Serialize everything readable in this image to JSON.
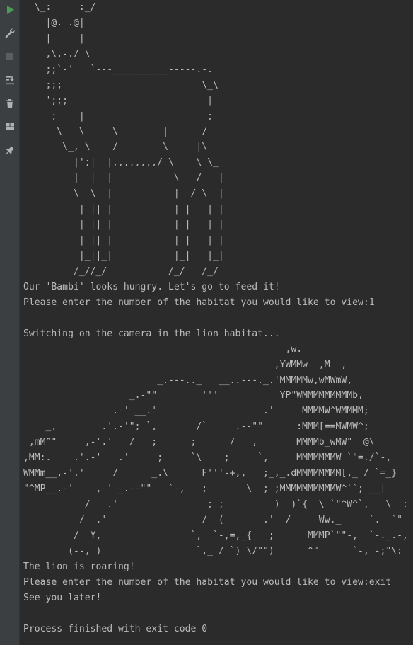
{
  "toolbar": {
    "icons": [
      "run-icon",
      "wrench-icon",
      "stop-icon",
      "scroll-to-end-icon",
      "trash-icon",
      "layout-icon",
      "pin-icon"
    ],
    "colors": {
      "run": "#499c54",
      "icon": "#afb1b3",
      "stop_disabled": "#5b5d5f"
    }
  },
  "console": {
    "lines": [
      "  \\_:     :_/",
      "    |@. .@|",
      "    |     |",
      "    ,\\.-./ \\",
      "    ;;`-'   `---__________-----.-.",
      "    ;;;                         \\_\\",
      "    ';;;                         |",
      "     ;    |                      ;",
      "      \\   \\     \\        |      /",
      "       \\_, \\    /        \\     |\\",
      "         |';|  |,,,,,,,,/ \\    \\ \\_",
      "         |  |  |           \\   /   |",
      "         \\  \\  |           |  / \\  |",
      "          | || |           | |   | |",
      "          | || |           | |   | |",
      "          | || |           | |   | |",
      "          |_||_|           |_|   |_|",
      "         /_//_/           /_/   /_/",
      "Our 'Bambi' looks hungry. Let's go to feed it!",
      "Please enter the number of the habitat you would like to view:1",
      "",
      "Switching on the camera in the lion habitat...",
      "                                               ,w.",
      "                                             ,YWMMw  ,M  ,",
      "                        _.---.._   __..---._.'MMMMMw,wMWmW,",
      "                   _.-\"\"        '''           YP\"WMMMMMMMMMb,",
      "                .-' __.'                   .'     MMMMW^WMMMM;",
      "    _,        .'.-'\"; `,       /`     .--\"\"      :MMM[==MWMW^;",
      " ,mM^\"     ,-'.'   /   ;      ;      /   ,       MMMMb_wMW\"  @\\",
      ",MM:.    .'.-'   .'     ;     `\\    ;     `,     MMMMMMMW `\"=./`-,",
      "WMMm__,-'.'     /      _.\\      F'''-+,,   ;_,_.dMMMMMMMM[,_ / `=_}",
      "\"^MP__.-'    ,-' _.--\"\"   `-,   ;       \\  ; ;MMMMMMMMMMW^``; __|",
      "           /   .'                ; ;         )  )`{  \\ `\"^W^`,   \\  :",
      "          /  .'                 /  (       .'  /     Ww._     `.  `\"",
      "         /  Y,                `,  `-,=,_{   ;      MMMP`\"\"-,  `-._.-,",
      "        (--, )                 `,_ / `) \\/\"\")      ^\"      `-, -;\"\\:",
      "The lion is roaring!",
      "Please enter the number of the habitat you would like to view:exit",
      "See you later!",
      "",
      "Process finished with exit code 0"
    ]
  }
}
